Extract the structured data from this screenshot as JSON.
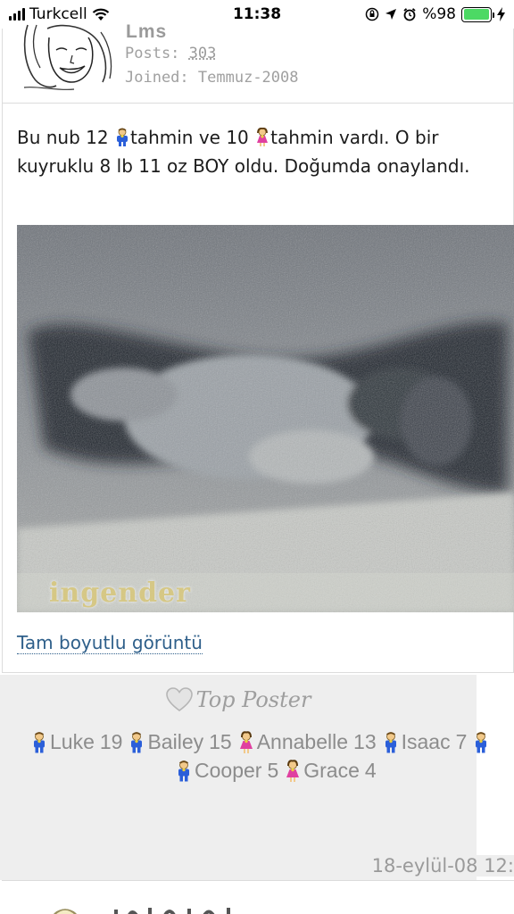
{
  "status_bar": {
    "carrier": "Turkcell",
    "time": "11:38",
    "battery_percent": "%98",
    "battery_level": 0.98,
    "icons": [
      "signal-icon",
      "wifi-icon",
      "orientation-lock-icon",
      "location-icon",
      "alarm-icon",
      "battery-icon",
      "charging-icon"
    ]
  },
  "user": {
    "name": "Lms",
    "posts_label": "Posts:",
    "posts_count": "303",
    "joined_label": "Joined:",
    "joined_value": "Temmuz-2008"
  },
  "post": {
    "text_part1": "Bu nub 12 ",
    "text_part2": "tahmin ve 10 ",
    "text_part3": "tahmin vardı. O bir kuyruklu 8 lb 11 oz BOY oldu. Doğumda onaylandı.",
    "image_watermark": "ingender",
    "full_size_link": "Tam boyutlu görüntü"
  },
  "signature": {
    "title": "Top Poster",
    "kids_line1": [
      {
        "name": "Luke",
        "age": "19",
        "gender": "boy"
      },
      {
        "name": "Bailey",
        "age": "15",
        "gender": "boy"
      },
      {
        "name": "Annabelle",
        "age": "13",
        "gender": "girl"
      },
      {
        "name": "Isaac",
        "age": "7",
        "gender": "boy"
      }
    ],
    "kids_line2": [
      {
        "name": "Cooper",
        "age": "5",
        "gender": "boy"
      },
      {
        "name": "Grace",
        "age": "4",
        "gender": "girl"
      }
    ]
  },
  "post_date": "18-eylül-08 12:",
  "colors": {
    "link": "#2e5f8a",
    "boy": "#2b5fd9",
    "girl": "#e040a0",
    "battery": "#4cd964",
    "signature_bg": "#eeeeee"
  }
}
